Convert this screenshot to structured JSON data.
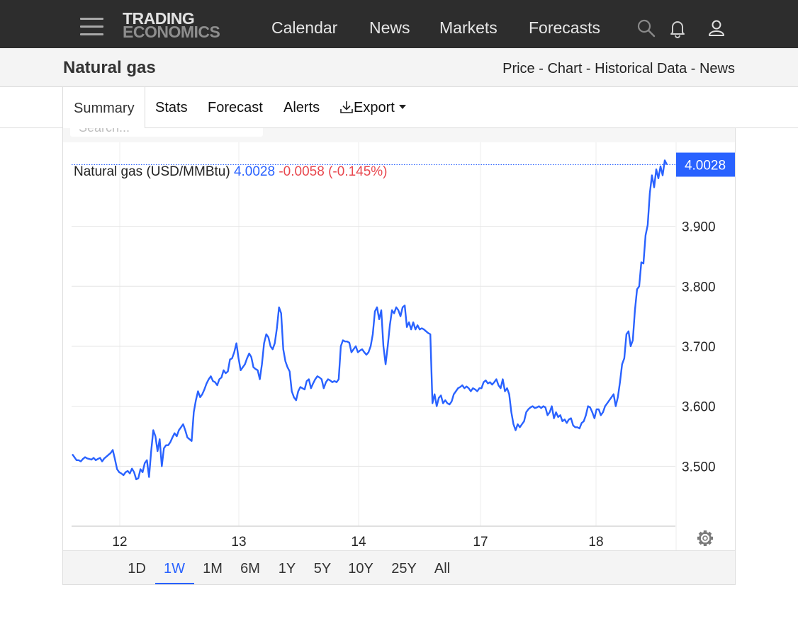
{
  "nav": {
    "logo_line1": "TRADING",
    "logo_line2": "ECONOMICS",
    "links": [
      "Calendar",
      "News",
      "Markets",
      "Forecasts"
    ]
  },
  "subheader": {
    "title": "Natural gas",
    "links": [
      "Price",
      "Chart",
      "Historical Data",
      "News"
    ],
    "separator": " - "
  },
  "tabs": {
    "summary": "Summary",
    "stats": "Stats",
    "forecast": "Forecast",
    "alerts": "Alerts",
    "export": "Export"
  },
  "ghost_search_placeholder": "Search...",
  "legend": {
    "name": "Natural gas (USD/MMBtu)",
    "last": "4.0028",
    "change": "-0.0058 (-0.145%)"
  },
  "range_buttons": [
    "1D",
    "1W",
    "1M",
    "6M",
    "1Y",
    "5Y",
    "10Y",
    "25Y",
    "All"
  ],
  "range_active": "1W",
  "colors": {
    "line": "#2962ff",
    "positive": "#2962ff",
    "negative": "#e8484f",
    "nav_bg": "#2d2d2d"
  },
  "chart_data": {
    "type": "line",
    "title": "Natural gas (USD/MMBtu)",
    "x_ticks": [
      "12",
      "13",
      "14",
      "17",
      "18"
    ],
    "y_ticks": [
      "3.500",
      "3.600",
      "3.700",
      "3.800",
      "3.900"
    ],
    "ylim": [
      3.4,
      4.04
    ],
    "last_value_label": "4.0028",
    "grid": true,
    "series": [
      {
        "values": [
          3.52,
          3.515,
          3.51,
          3.51,
          3.508,
          3.512,
          3.515,
          3.513,
          3.512,
          3.511,
          3.514,
          3.51,
          3.512,
          3.514,
          3.508,
          3.513,
          3.516,
          3.519,
          3.522,
          3.527,
          3.512,
          3.495,
          3.49,
          3.488,
          3.485,
          3.49,
          3.492,
          3.488,
          3.496,
          3.49,
          3.478,
          3.48,
          3.495,
          3.49,
          3.505,
          3.51,
          3.482,
          3.525,
          3.56,
          3.55,
          3.525,
          3.545,
          3.5,
          3.53,
          3.535,
          3.535,
          3.54,
          3.548,
          3.555,
          3.55,
          3.56,
          3.565,
          3.57,
          3.56,
          3.548,
          3.545,
          3.542,
          3.59,
          3.61,
          3.625,
          3.615,
          3.62,
          3.628,
          3.638,
          3.645,
          3.65,
          3.642,
          3.64,
          3.635,
          3.645,
          3.648,
          3.66,
          3.655,
          3.658,
          3.678,
          3.68,
          3.69,
          3.705,
          3.68,
          3.66,
          3.665,
          3.67,
          3.68,
          3.688,
          3.682,
          3.665,
          3.662,
          3.66,
          3.645,
          3.67,
          3.705,
          3.72,
          3.715,
          3.7,
          3.695,
          3.705,
          3.73,
          3.765,
          3.755,
          3.695,
          3.675,
          3.665,
          3.658,
          3.625,
          3.615,
          3.61,
          3.625,
          3.632,
          3.63,
          3.628,
          3.642,
          3.645,
          3.63,
          3.638,
          3.645,
          3.65,
          3.648,
          3.645,
          3.63,
          3.64,
          3.645,
          3.643,
          3.64,
          3.642,
          3.64,
          3.645,
          3.7,
          3.71,
          3.708,
          3.708,
          3.706,
          3.69,
          3.695,
          3.7,
          3.69,
          3.693,
          3.695,
          3.69,
          3.686,
          3.69,
          3.7,
          3.72,
          3.758,
          3.765,
          3.745,
          3.76,
          3.7,
          3.67,
          3.7,
          3.735,
          3.76,
          3.755,
          3.765,
          3.76,
          3.75,
          3.765,
          3.768,
          3.732,
          3.74,
          3.728,
          3.74,
          3.728,
          3.735,
          3.728,
          3.73,
          3.728,
          3.725,
          3.722,
          3.72,
          3.605,
          3.62,
          3.6,
          3.614,
          3.618,
          3.605,
          3.61,
          3.605,
          3.603,
          3.608,
          3.62,
          3.625,
          3.63,
          3.632,
          3.635,
          3.63,
          3.633,
          3.63,
          3.625,
          3.63,
          3.628,
          3.625,
          3.63,
          3.63,
          3.64,
          3.643,
          3.638,
          3.64,
          3.636,
          3.64,
          3.645,
          3.635,
          3.63,
          3.645,
          3.625,
          3.63,
          3.62,
          3.59,
          3.57,
          3.56,
          3.57,
          3.565,
          3.57,
          3.575,
          3.59,
          3.595,
          3.598,
          3.6,
          3.597,
          3.598,
          3.6,
          3.597,
          3.6,
          3.598,
          3.585,
          3.59,
          3.6,
          3.58,
          3.59,
          3.582,
          3.585,
          3.575,
          3.578,
          3.572,
          3.578,
          3.58,
          3.568,
          3.565,
          3.565,
          3.563,
          3.572,
          3.575,
          3.585,
          3.6,
          3.598,
          3.59,
          3.58,
          3.595,
          3.595,
          3.585,
          3.59,
          3.6,
          3.605,
          3.61,
          3.615,
          3.62,
          3.6,
          3.615,
          3.64,
          3.67,
          3.68,
          3.72,
          3.725,
          3.7,
          3.71,
          3.76,
          3.795,
          3.8,
          3.84,
          3.838,
          3.885,
          3.902,
          3.955,
          3.985,
          3.965,
          3.995,
          3.98,
          4.0,
          3.985,
          4.01,
          4.0028
        ]
      }
    ]
  }
}
